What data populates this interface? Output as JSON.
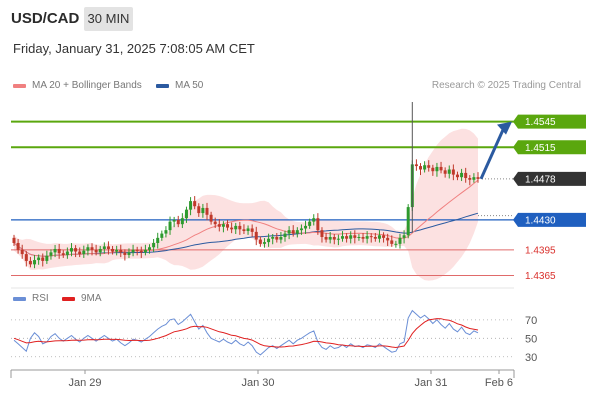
{
  "header": {
    "symbol": "USD/CAD",
    "timeframe": "30 MIN",
    "datetime": "Friday, January 31, 2025 7:08:05 AM CET"
  },
  "legend": {
    "ma20_bollinger": "MA 20 + Bollinger Bands",
    "ma50": "MA 50",
    "copyright": "Research © 2025 Trading Central"
  },
  "rsi_legend": {
    "rsi": "RSI",
    "ma9": "9MA"
  },
  "colors": {
    "bull_candle": "#2e9a2e",
    "bear_candle": "#c0392b",
    "bollinger_fill": "#fcdcdc",
    "ma20": "#f08080",
    "ma50": "#2b5aa0",
    "resistance": "#5aa70e",
    "pivot": "#1f5fbf",
    "support": "#e06a6a",
    "last_price": "#333333",
    "rsi": "#6b8fd6",
    "rsi_ma": "#e02020"
  },
  "chart_data": [
    {
      "type": "candlestick",
      "title": "USD/CAD 30 MIN",
      "x_ticks": [
        "Jan 29",
        "Jan 30",
        "Jan 31",
        "Feb 6"
      ],
      "ylim": [
        1.4355,
        1.4575
      ],
      "levels": [
        {
          "name": "resistance 2",
          "value": 1.4545,
          "label": "1.4545",
          "kind": "resistance"
        },
        {
          "name": "resistance 1",
          "value": 1.4515,
          "label": "1.4515",
          "kind": "resistance"
        },
        {
          "name": "last price",
          "value": 1.4478,
          "label": "1.4478",
          "kind": "last"
        },
        {
          "name": "pivot",
          "value": 1.443,
          "label": "1.4430",
          "kind": "pivot"
        },
        {
          "name": "support 1",
          "value": 1.4395,
          "label": "1.4395",
          "kind": "support"
        },
        {
          "name": "support 2",
          "value": 1.4365,
          "label": "1.4365",
          "kind": "support"
        }
      ],
      "projection": {
        "from": 1.4478,
        "to": 1.4545
      },
      "series": [
        {
          "name": "MA 20 + Bollinger Bands"
        },
        {
          "name": "MA 50"
        }
      ],
      "close": [
        1.4403,
        1.4395,
        1.439,
        1.4382,
        1.4378,
        1.4383,
        1.4386,
        1.4382,
        1.4388,
        1.4392,
        1.4396,
        1.4391,
        1.4389,
        1.4393,
        1.4397,
        1.4393,
        1.439,
        1.4394,
        1.4398,
        1.4395,
        1.4392,
        1.4396,
        1.4399,
        1.4396,
        1.4393,
        1.4395,
        1.4392,
        1.4389,
        1.4392,
        1.4395,
        1.4394,
        1.4392,
        1.4395,
        1.4398,
        1.4403,
        1.4409,
        1.4414,
        1.4418,
        1.4428,
        1.443,
        1.4425,
        1.4432,
        1.4442,
        1.4452,
        1.4446,
        1.4438,
        1.4444,
        1.4436,
        1.4428,
        1.4425,
        1.4422,
        1.4425,
        1.4421,
        1.4419,
        1.4423,
        1.4419,
        1.4417,
        1.442,
        1.4416,
        1.4407,
        1.4402,
        1.4404,
        1.4408,
        1.441,
        1.4407,
        1.441,
        1.4414,
        1.4418,
        1.4414,
        1.4418,
        1.442,
        1.4423,
        1.4428,
        1.4432,
        1.4418,
        1.441,
        1.4407,
        1.441,
        1.4407,
        1.4408,
        1.4411,
        1.4408,
        1.4412,
        1.4409,
        1.441,
        1.4408,
        1.4411,
        1.441,
        1.4408,
        1.4412,
        1.4409,
        1.4406,
        1.4402,
        1.4402,
        1.4409,
        1.4412,
        1.4445,
        1.4495,
        1.4493,
        1.4489,
        1.4494,
        1.4491,
        1.4487,
        1.4492,
        1.4488,
        1.4484,
        1.4489,
        1.4483,
        1.448,
        1.4485,
        1.4479,
        1.4477,
        1.448,
        1.4478
      ],
      "rsi_ticks": [
        70,
        50,
        30
      ],
      "rsi_ylim": [
        20,
        85
      ],
      "rsi": [
        48,
        44,
        40,
        36,
        50,
        56,
        52,
        44,
        46,
        52,
        55,
        50,
        47,
        50,
        53,
        49,
        46,
        50,
        53,
        50,
        47,
        50,
        53,
        50,
        47,
        49,
        45,
        42,
        45,
        49,
        48,
        46,
        49,
        52,
        56,
        60,
        63,
        65,
        70,
        71,
        65,
        68,
        72,
        76,
        68,
        60,
        64,
        56,
        50,
        48,
        46,
        49,
        46,
        44,
        48,
        44,
        42,
        46,
        42,
        35,
        32,
        36,
        40,
        42,
        39,
        42,
        45,
        48,
        44,
        48,
        50,
        53,
        56,
        58,
        46,
        40,
        38,
        42,
        39,
        40,
        43,
        40,
        44,
        41,
        42,
        40,
        43,
        42,
        40,
        44,
        41,
        38,
        35,
        36,
        44,
        46,
        72,
        80,
        76,
        72,
        75,
        71,
        66,
        70,
        65,
        61,
        66,
        60,
        57,
        62,
        56,
        54,
        58,
        56
      ],
      "rsi_ma": [
        50,
        48.5,
        46.8,
        45,
        45.4,
        46.3,
        46.9,
        46.2,
        46.1,
        46.6,
        47.2,
        47.4,
        47.3,
        47.5,
        48,
        48.1,
        47.9,
        48.1,
        48.5,
        48.6,
        48.5,
        48.6,
        48.9,
        49,
        48.8,
        48.8,
        48.5,
        47.9,
        47.6,
        47.7,
        47.7,
        47.5,
        47.6,
        48,
        48.8,
        50,
        51.4,
        52.9,
        55,
        57,
        57.9,
        59,
        60.3,
        62.2,
        63,
        62.6,
        62.7,
        61.9,
        60.3,
        58.7,
        57.1,
        56.2,
        54.8,
        53.3,
        52.7,
        51.3,
        49.9,
        49.3,
        48.1,
        45.8,
        43.4,
        41.9,
        41.3,
        41,
        40.6,
        40.6,
        40.9,
        41.6,
        41.7,
        42.4,
        43.2,
        44.2,
        45.4,
        46.8,
        46.7,
        46,
        45,
        44.7,
        43.9,
        43.1,
        42.8,
        42.1,
        42,
        41.6,
        41.5,
        41.1,
        41.3,
        41.4,
        41.3,
        41.8,
        41.8,
        41.4,
        40.6,
        40,
        40.8,
        41.7,
        47.7,
        55.1,
        60.2,
        64,
        67.6,
        69.9,
        70.6,
        71.4,
        71.2,
        70,
        69.5,
        67.9,
        65.7,
        64.4,
        62.3,
        60.6,
        59.9,
        59
      ]
    }
  ]
}
